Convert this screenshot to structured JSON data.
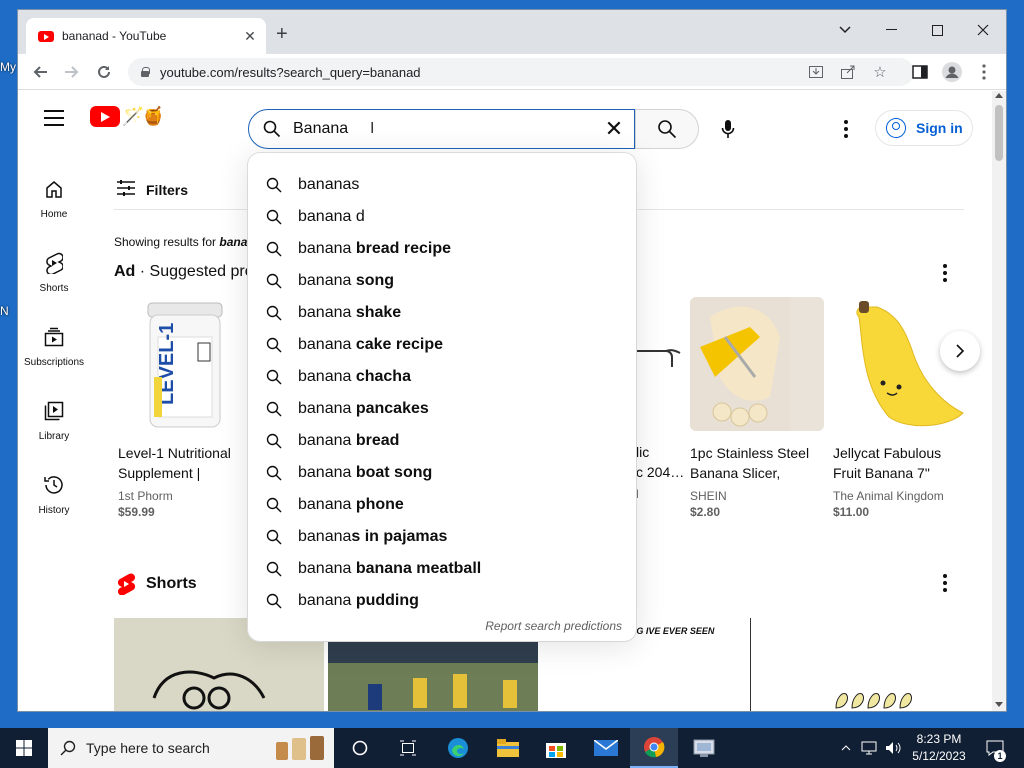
{
  "desktop": {
    "fragments": [
      "My",
      "N"
    ]
  },
  "browser": {
    "tab_title": "bananad - YouTube",
    "url": "youtube.com/results?search_query=bananad"
  },
  "yt": {
    "search_value": "Banana",
    "signin_label": "Sign in",
    "sidebar": [
      {
        "label": "Home",
        "icon": "home-icon"
      },
      {
        "label": "Shorts",
        "icon": "shorts-icon"
      },
      {
        "label": "Subscriptions",
        "icon": "subscriptions-icon"
      },
      {
        "label": "Library",
        "icon": "library-icon"
      },
      {
        "label": "History",
        "icon": "history-icon"
      }
    ],
    "filters_label": "Filters",
    "showing_prefix": "Showing results for",
    "showing_term": "banana",
    "ad_label": "Ad",
    "ad_title": "· Suggested products",
    "products": [
      {
        "title1": "Level-1 Nutritional",
        "title2": "Supplement |",
        "seller": "1st Phorm",
        "price": "$59.99"
      },
      {
        "title1": "1pc Stainless Steel",
        "title2": "Banana Slicer,",
        "seller": "SHEIN",
        "price": "$2.80"
      },
      {
        "title1": "Jellycat Fabulous",
        "title2": "Fruit Banana 7\"",
        "seller": "The Animal Kingdom",
        "price": "$11.00"
      }
    ],
    "partial_product": {
      "line1": "lic",
      "line2": "c 204…",
      "line3": "l"
    },
    "shorts_label": "Shorts",
    "short_caption": "BEAUTIFUL THING IVE EVER SEEN",
    "suggestions": [
      {
        "prefix": "banana",
        "suffix": "s"
      },
      {
        "prefix": "banana",
        "suffix": " d"
      },
      {
        "prefix": "banana",
        "suffix": " bread recipe"
      },
      {
        "prefix": "banana",
        "suffix": " song"
      },
      {
        "prefix": "banana",
        "suffix": " shake"
      },
      {
        "prefix": "banana",
        "suffix": " cake recipe"
      },
      {
        "prefix": "banana",
        "suffix": " chacha"
      },
      {
        "prefix": "banana",
        "suffix": " pancakes"
      },
      {
        "prefix": "banana",
        "suffix": " bread"
      },
      {
        "prefix": "banana",
        "suffix": " boat song"
      },
      {
        "prefix": "banana",
        "suffix": " phone"
      },
      {
        "prefix": "banana",
        "suffix": "s in pajamas"
      },
      {
        "prefix": "banana",
        "suffix": " banana meatball"
      },
      {
        "prefix": "banana",
        "suffix": " pudding"
      }
    ],
    "report_label": "Report search predictions"
  },
  "taskbar": {
    "search_placeholder": "Type here to search",
    "time": "8:23 PM",
    "date": "5/12/2023",
    "notification_count": "1"
  },
  "colors": {
    "brand_red": "#ff0000",
    "link_blue": "#065fd4",
    "taskbar": "#101f33",
    "desktop": "#1e6cc6"
  }
}
